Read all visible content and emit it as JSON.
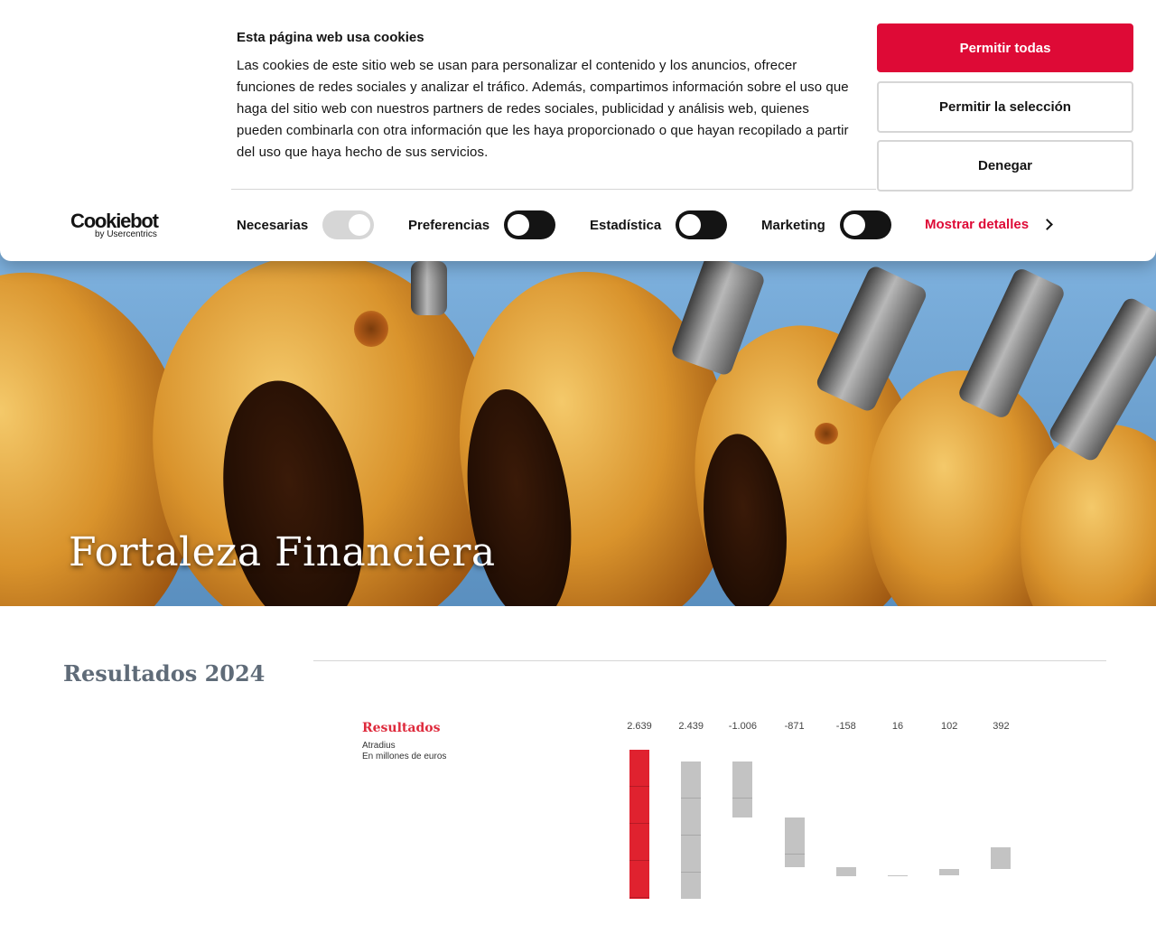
{
  "cookie_banner": {
    "title": "Esta página web usa cookies",
    "text": "Las cookies de este sitio web se usan para personalizar el contenido y los anuncios, ofrecer funciones de redes sociales y analizar el tráfico. Además, compartimos información sobre el uso que haga del sitio web con nuestros partners de redes sociales, publicidad y análisis web, quienes pueden combinarla con otra información que les haya proporcionado o que hayan recopilado a partir del uso que haya hecho de sus servicios.",
    "buttons": {
      "allow_all": "Permitir todas",
      "allow_selection": "Permitir la selección",
      "deny": "Denegar"
    },
    "logo": {
      "main": "Cookiebot",
      "sub": "by Usercentrics"
    },
    "toggles": [
      {
        "label": "Necesarias",
        "state": "on",
        "disabled": true
      },
      {
        "label": "Preferencias",
        "state": "off",
        "disabled": false
      },
      {
        "label": "Estadística",
        "state": "off",
        "disabled": false
      },
      {
        "label": "Marketing",
        "state": "off",
        "disabled": false
      }
    ],
    "details_link": "Mostrar detalles"
  },
  "hero": {
    "title": "Fortaleza Financiera"
  },
  "section": {
    "title": "Resultados 2024"
  },
  "chart_data": {
    "type": "bar",
    "title": "Resultados",
    "subtitle_lines": [
      "Atradius",
      "En millones de euros"
    ],
    "values": [
      2639,
      2439,
      -1006,
      -871,
      -158,
      16,
      102,
      392
    ],
    "value_labels": [
      "2.639",
      "2.439",
      "-1.006",
      "-871",
      "-158",
      "16",
      "102",
      "392"
    ],
    "bar_colors": [
      "#e0222f",
      "#c3c3c3",
      "#c3c3c3",
      "#c3c3c3",
      "#c3c3c3",
      "#c3c3c3",
      "#c3c3c3",
      "#c3c3c3"
    ]
  },
  "colors": {
    "accent": "#de0a36",
    "text": "#141414",
    "section_title": "#5f6b78"
  }
}
